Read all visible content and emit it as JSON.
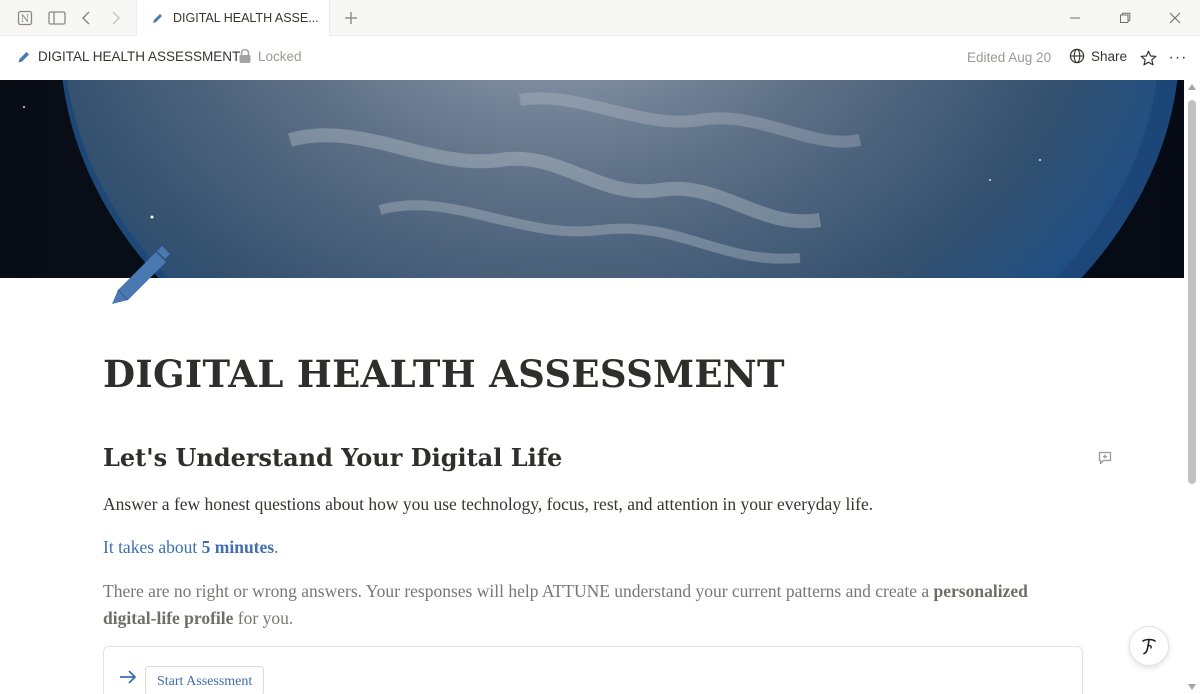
{
  "tab": {
    "title": "DIGITAL HEALTH ASSE..."
  },
  "topbar": {
    "breadcrumb": "DIGITAL HEALTH ASSESSMENT",
    "locked": "Locked",
    "edited": "Edited Aug 20",
    "share": "Share",
    "more": "···"
  },
  "page": {
    "title": "DIGITAL HEALTH ASSESSMENT",
    "heading": "Let's Understand Your Digital Life",
    "intro": "Answer a few honest questions about how you use technology, focus, rest, and attention in your everyday life.",
    "duration_prefix": "It takes about ",
    "duration_value": "5 minutes",
    "duration_suffix": ".",
    "note_part1": "There are no right or wrong answers. Your responses will help ATTUNE understand your current patterns and create a ",
    "note_bold": "personalized digital-life profile",
    "note_part2": " for you.",
    "start_button": "Start Assessment"
  },
  "colors": {
    "accent_blue": "#3f6fb0",
    "pencil_blue": "#4a78b0",
    "text_dark": "#37352f",
    "text_muted": "#9b9a97"
  },
  "icons": {
    "app": "notion-logo-icon",
    "sidebar": "sidebar-toggle-icon",
    "back": "back-arrow-icon",
    "forward": "forward-arrow-icon",
    "page": "pencil-icon",
    "lock": "lock-icon",
    "share": "globe-icon",
    "favorite": "star-icon",
    "comment": "comment-icon",
    "callout": "arrow-right-icon",
    "help": "help-icon"
  }
}
